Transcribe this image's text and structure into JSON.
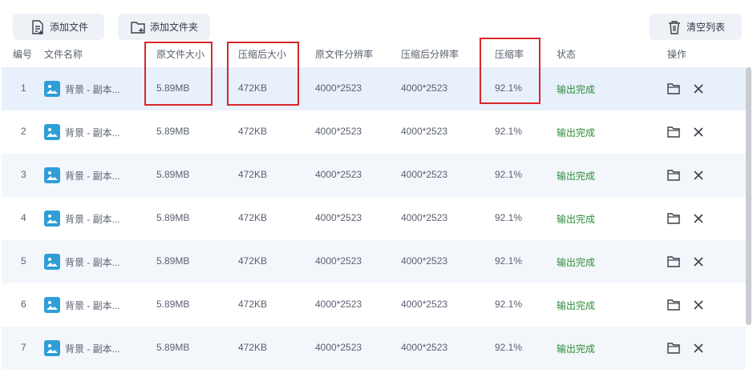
{
  "toolbar": {
    "add_file_label": "添加文件",
    "add_folder_label": "添加文件夹",
    "clear_list_label": "清空列表"
  },
  "columns": {
    "index": "编号",
    "name": "文件名称",
    "orig_size": "原文件大小",
    "comp_size": "压缩后大小",
    "orig_res": "原文件分辨率",
    "comp_res": "压缩后分辨率",
    "ratio": "压缩率",
    "status": "状态",
    "actions": "操作"
  },
  "rows": [
    {
      "index": "1",
      "name": "背景 - 副本...",
      "orig_size": "5.89MB",
      "comp_size": "472KB",
      "orig_res": "4000*2523",
      "comp_res": "4000*2523",
      "ratio": "92.1%",
      "status": "输出完成"
    },
    {
      "index": "2",
      "name": "背景 - 副本...",
      "orig_size": "5.89MB",
      "comp_size": "472KB",
      "orig_res": "4000*2523",
      "comp_res": "4000*2523",
      "ratio": "92.1%",
      "status": "输出完成"
    },
    {
      "index": "3",
      "name": "背景 - 副本...",
      "orig_size": "5.89MB",
      "comp_size": "472KB",
      "orig_res": "4000*2523",
      "comp_res": "4000*2523",
      "ratio": "92.1%",
      "status": "输出完成"
    },
    {
      "index": "4",
      "name": "背景 - 副本...",
      "orig_size": "5.89MB",
      "comp_size": "472KB",
      "orig_res": "4000*2523",
      "comp_res": "4000*2523",
      "ratio": "92.1%",
      "status": "输出完成"
    },
    {
      "index": "5",
      "name": "背景 - 副本...",
      "orig_size": "5.89MB",
      "comp_size": "472KB",
      "orig_res": "4000*2523",
      "comp_res": "4000*2523",
      "ratio": "92.1%",
      "status": "输出完成"
    },
    {
      "index": "6",
      "name": "背景 - 副本...",
      "orig_size": "5.89MB",
      "comp_size": "472KB",
      "orig_res": "4000*2523",
      "comp_res": "4000*2523",
      "ratio": "92.1%",
      "status": "输出完成"
    },
    {
      "index": "7",
      "name": "背景 - 副本...",
      "orig_size": "5.89MB",
      "comp_size": "472KB",
      "orig_res": "4000*2523",
      "comp_res": "4000*2523",
      "ratio": "92.1%",
      "status": "输出完成"
    }
  ],
  "icons": {
    "add_file": "file-add-icon",
    "add_folder": "folder-add-icon",
    "clear": "trash-icon",
    "thumbnail": "image-icon",
    "open_folder": "folder-icon",
    "delete": "close-icon"
  },
  "colors": {
    "status_done": "#2e8b3a",
    "selected_row": "#e8f0fb",
    "alt_row": "#f3f7fb",
    "highlight_box": "#d9262c",
    "thumbnail": "#2f9ed6"
  }
}
